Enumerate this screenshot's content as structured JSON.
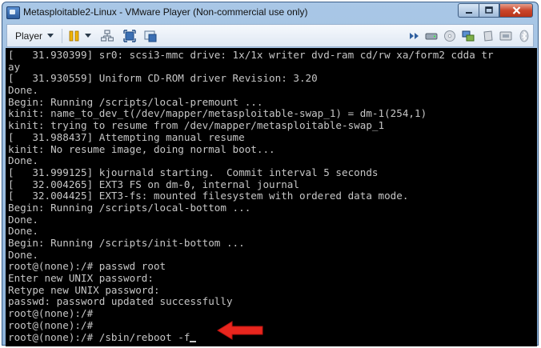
{
  "window": {
    "title": "Metasploitable2-Linux - VMware Player (Non-commercial use only)"
  },
  "toolbar": {
    "player_label": "Player",
    "icons": [
      "pause-icon",
      "network-icon",
      "fullscreen-icon",
      "unity-icon",
      "arrows-icon",
      "hard-drive-icon",
      "cd-icon",
      "network-adapter-icon",
      "usb-icon",
      "floppy-icon",
      "bluetooth-icon"
    ]
  },
  "terminal": {
    "lines": [
      "[   31.930399] sr0: scsi3-mmc drive: 1x/1x writer dvd-ram cd/rw xa/form2 cdda tr",
      "ay",
      "[   31.930559] Uniform CD-ROM driver Revision: 3.20",
      "Done.",
      "Begin: Running /scripts/local-premount ...",
      "kinit: name_to_dev_t(/dev/mapper/metasploitable-swap_1) = dm-1(254,1)",
      "kinit: trying to resume from /dev/mapper/metasploitable-swap_1",
      "[   31.988437] Attempting manual resume",
      "kinit: No resume image, doing normal boot...",
      "Done.",
      "[   31.999125] kjournald starting.  Commit interval 5 seconds",
      "[   32.004265] EXT3 FS on dm-0, internal journal",
      "[   32.004425] EXT3-fs: mounted filesystem with ordered data mode.",
      "Begin: Running /scripts/local-bottom ...",
      "Done.",
      "Done.",
      "Begin: Running /scripts/init-bottom ...",
      "Done.",
      "root@(none):/# passwd root",
      "Enter new UNIX password:",
      "Retype new UNIX password:",
      "passwd: password updated successfully",
      "root@(none):/#",
      "root@(none):/#",
      "root@(none):/# /sbin/reboot -f"
    ]
  },
  "colors": {
    "terminal_bg": "#000000",
    "terminal_fg": "#c6c6c6",
    "annotation_arrow": "#e8261e"
  }
}
